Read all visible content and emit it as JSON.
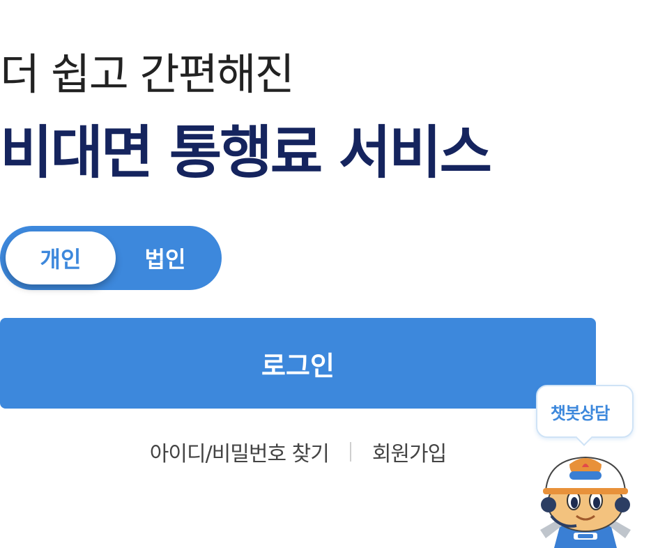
{
  "hero": {
    "subtitle": "더 쉽고 간편해진",
    "title": "비대면 통행료 서비스"
  },
  "member_type": {
    "options": [
      "개인",
      "법인"
    ],
    "selected": "개인"
  },
  "login": {
    "label": "로그인"
  },
  "links": {
    "find_account": "아이디/비밀번호 찾기",
    "signup": "회원가입"
  },
  "chatbot": {
    "label": "챗봇상담"
  },
  "colors": {
    "primary": "#3d88dc",
    "title": "#15245e",
    "text": "#444444"
  }
}
